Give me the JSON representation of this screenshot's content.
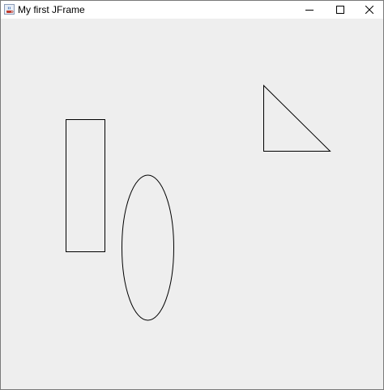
{
  "window": {
    "title": "My first JFrame",
    "icon": "java-cup-icon",
    "controls": {
      "minimize_icon": "minimize-icon",
      "maximize_icon": "maximize-icon",
      "close_icon": "close-icon"
    }
  },
  "colors": {
    "content_background": "#eeeeee",
    "titlebar_background": "#ffffff",
    "shape_stroke": "#000000"
  },
  "canvas": {
    "shapes": [
      "rectangle",
      "ellipse",
      "triangle"
    ]
  }
}
